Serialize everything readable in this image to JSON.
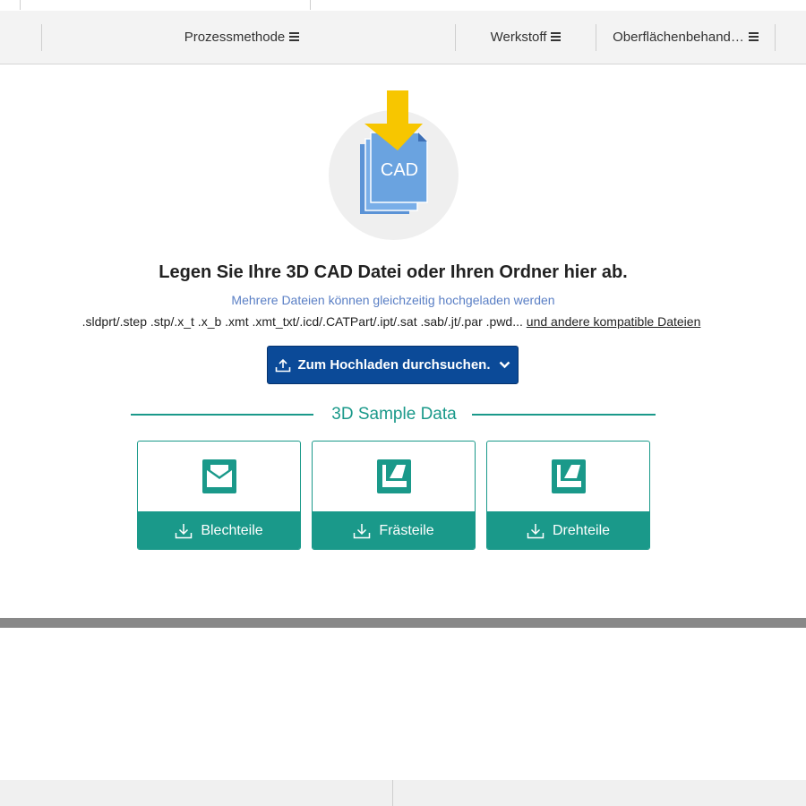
{
  "header": {
    "columns": [
      {
        "label": "Prozessmethode",
        "icon": "menu-icon"
      },
      {
        "label": "Werkstoff",
        "icon": "menu-icon"
      },
      {
        "label": "Oberflächenbehand…",
        "icon": "menu-icon"
      }
    ]
  },
  "upload": {
    "icon_label": "CAD",
    "title": "Legen Sie Ihre 3D CAD Datei oder Ihren Ordner hier ab.",
    "subtitle": "Mehrere Dateien können gleichzeitig hochgeladen werden",
    "formats_text": ".sldprt/.step .stp/.x_t .x_b .xmt .xmt_txt/.icd/.CATPart/.ipt/.sat .sab/.jt/.par .pwd...",
    "formats_link": "und andere kompatible Dateien",
    "browse_button": "Zum Hochladen durchsuchen."
  },
  "samples": {
    "title": "3D Sample Data",
    "cards": [
      {
        "label": "Blechteile",
        "icon": "sheet-metal-icon"
      },
      {
        "label": "Frästeile",
        "icon": "milling-icon"
      },
      {
        "label": "Drehteile",
        "icon": "turning-icon"
      }
    ]
  },
  "colors": {
    "teal": "#1a998a",
    "button_blue": "#0b4a98",
    "subtitle_blue": "#5a7fc5",
    "arrow_yellow": "#f7c600",
    "doc_blue": "#6aa3e0"
  }
}
